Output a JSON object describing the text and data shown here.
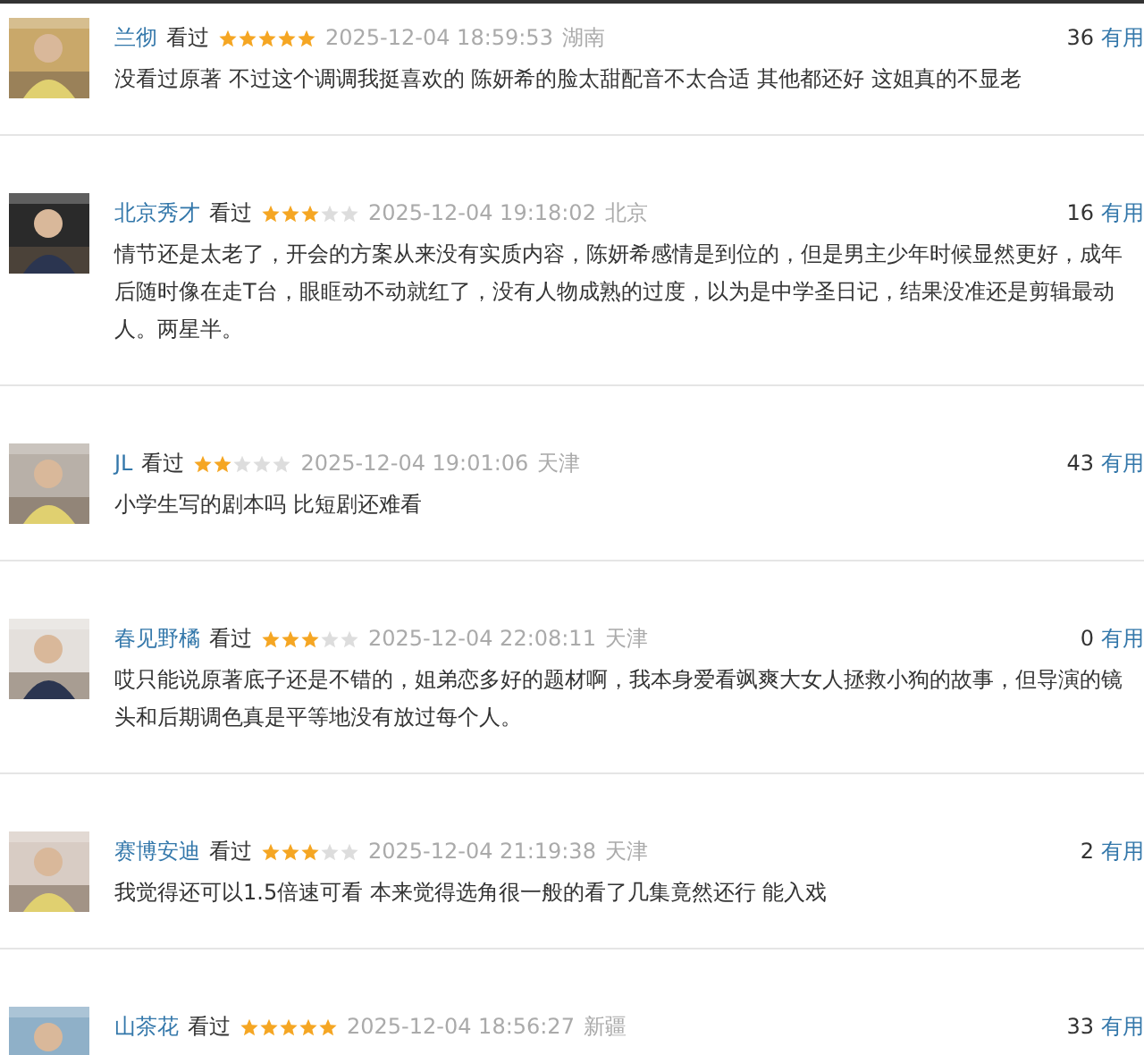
{
  "comments": [
    {
      "user": "兰彻",
      "status": "看过",
      "stars": 5,
      "time": "2025-12-04 18:59:53",
      "region": "湖南",
      "votes": "36",
      "useful": "有用",
      "text": "没看过原著 不过这个调调我挺喜欢的 陈妍希的脸太甜配音不太合适 其他都还好 这姐真的不显老"
    },
    {
      "user": "北京秀才",
      "status": "看过",
      "stars": 3,
      "time": "2025-12-04 19:18:02",
      "region": "北京",
      "votes": "16",
      "useful": "有用",
      "text": "情节还是太老了，开会的方案从来没有实质内容，陈妍希感情是到位的，但是男主少年时候显然更好，成年后随时像在走T台，眼眶动不动就红了，没有人物成熟的过度，以为是中学圣日记，结果没准还是剪辑最动人。两星半。"
    },
    {
      "user": "JL",
      "status": "看过",
      "stars": 2,
      "time": "2025-12-04 19:01:06",
      "region": "天津",
      "votes": "43",
      "useful": "有用",
      "text": "小学生写的剧本吗 比短剧还难看"
    },
    {
      "user": "春见野橘",
      "status": "看过",
      "stars": 3,
      "time": "2025-12-04 22:08:11",
      "region": "天津",
      "votes": "0",
      "useful": "有用",
      "text": "哎只能说原著底子还是不错的，姐弟恋多好的题材啊，我本身爱看飒爽大女人拯救小狗的故事，但导演的镜头和后期调色真是平等地没有放过每个人。"
    },
    {
      "user": "赛博安迪",
      "status": "看过",
      "stars": 3,
      "time": "2025-12-04 21:19:38",
      "region": "天津",
      "votes": "2",
      "useful": "有用",
      "text": "我觉得还可以1.5倍速可看 本来觉得选角很一般的看了几集竟然还行 能入戏"
    },
    {
      "user": "山茶花",
      "status": "看过",
      "stars": 5,
      "time": "2025-12-04 18:56:27",
      "region": "新疆",
      "votes": "33",
      "useful": "有用"
    }
  ]
}
